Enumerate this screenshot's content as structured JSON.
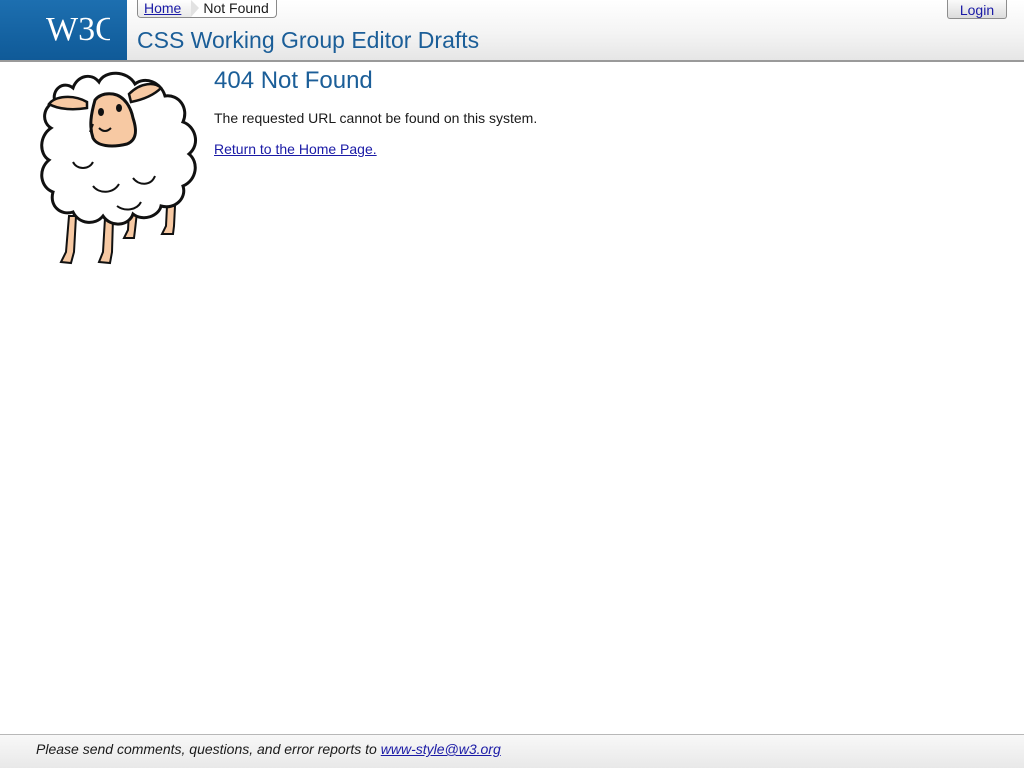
{
  "header": {
    "logo_text": "W3C",
    "breadcrumb": {
      "home_label": "Home",
      "current_label": "Not Found"
    },
    "site_title": "CSS Working Group Editor Drafts",
    "login_label": "Login"
  },
  "main": {
    "image_icon": "sheep-illustration",
    "heading": "404 Not Found",
    "message": "The requested URL cannot be found on this system.",
    "return_link": "Return to the Home Page."
  },
  "footer": {
    "text": "Please send comments, questions, and error reports to ",
    "email_link": "www-style@w3.org"
  },
  "colors": {
    "brand_blue": "#1b5e98",
    "logo_bg": "#1565a8",
    "link": "#1a1aa6"
  }
}
